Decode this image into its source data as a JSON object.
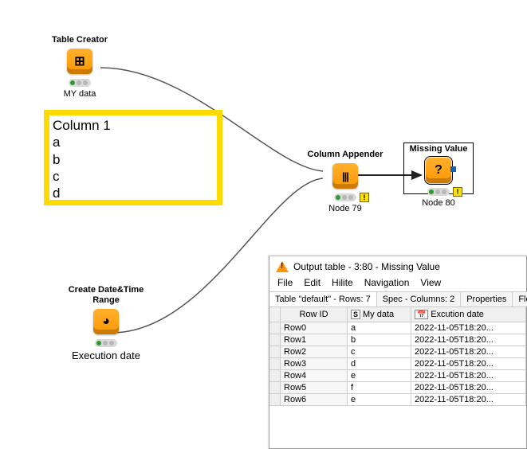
{
  "nodes": {
    "table_creator": {
      "title": "Table Creator",
      "caption": "MY data",
      "icon_glyph": "⊞"
    },
    "datetime_range": {
      "title": "Create Date&Time Range",
      "caption": "Execution date",
      "icon_glyph": "◕"
    },
    "column_appender": {
      "title": "Column Appender",
      "caption": "Node 79",
      "icon_glyph": "|||"
    },
    "missing_value": {
      "title": "Missing Value",
      "caption": "Node 80",
      "icon_glyph": "?"
    }
  },
  "note": {
    "heading": "Column 1",
    "rows": [
      "a",
      "b",
      "c",
      "d"
    ]
  },
  "output_window": {
    "title": "Output table - 3:80 - Missing Value",
    "menu": [
      "File",
      "Edit",
      "Hilite",
      "Navigation",
      "View"
    ],
    "tabs": [
      {
        "label": "Table \"default\" - Rows: 7",
        "active": true
      },
      {
        "label": "Spec - Columns: 2",
        "active": false
      },
      {
        "label": "Properties",
        "active": false
      },
      {
        "label": "Flow Va",
        "active": false
      }
    ],
    "columns": [
      {
        "id": "rowid",
        "label": "Row ID",
        "type": ""
      },
      {
        "id": "mydata",
        "label": "My data",
        "type": "S"
      },
      {
        "id": "exec",
        "label": "Excution date",
        "type": "cal"
      }
    ],
    "rows": [
      {
        "id": "Row0",
        "mydata": "a",
        "exec": "2022-11-05T18:20..."
      },
      {
        "id": "Row1",
        "mydata": "b",
        "exec": "2022-11-05T18:20..."
      },
      {
        "id": "Row2",
        "mydata": "c",
        "exec": "2022-11-05T18:20..."
      },
      {
        "id": "Row3",
        "mydata": "d",
        "exec": "2022-11-05T18:20..."
      },
      {
        "id": "Row4",
        "mydata": "e",
        "exec": "2022-11-05T18:20..."
      },
      {
        "id": "Row5",
        "mydata": "f",
        "exec": "2022-11-05T18:20..."
      },
      {
        "id": "Row6",
        "mydata": "e",
        "exec": "2022-11-05T18:20..."
      }
    ]
  }
}
